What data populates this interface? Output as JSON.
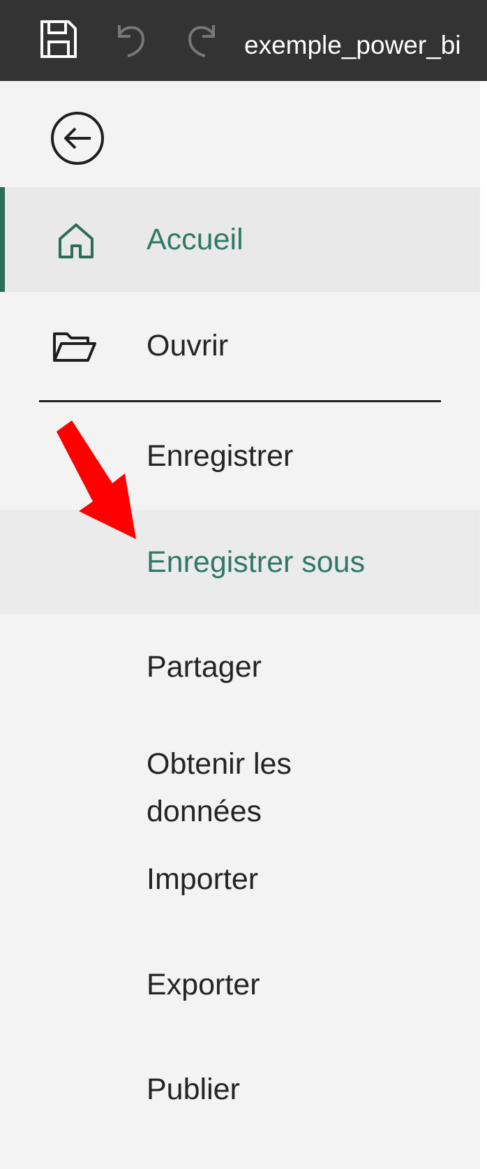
{
  "titlebar": {
    "file_name": "exemple_power_bi",
    "icons": {
      "save": "save-icon",
      "undo": "undo-icon",
      "redo": "redo-icon"
    },
    "background": "#333333"
  },
  "back": {
    "icon": "back-arrow-circle-icon"
  },
  "menu": {
    "items": [
      {
        "label": "Accueil",
        "icon": "home-icon",
        "state": "selected"
      },
      {
        "label": "Ouvrir",
        "icon": "folder-open-icon",
        "state": "normal"
      },
      {
        "label": "Enregistrer",
        "state": "normal"
      },
      {
        "label": "Enregistrer sous",
        "state": "hover"
      },
      {
        "label": "Partager",
        "state": "normal"
      },
      {
        "label": "Obtenir les données",
        "state": "normal"
      },
      {
        "label": "Importer",
        "state": "normal"
      },
      {
        "label": "Exporter",
        "state": "normal"
      },
      {
        "label": "Publier",
        "state": "normal"
      }
    ]
  },
  "annotation": {
    "icon": "red-arrow-annotation",
    "color": "#ff0000",
    "target": "Enregistrer sous"
  },
  "colors": {
    "accent": "#2e6c5a",
    "accent_text": "#2f7a66",
    "panel": "#f3f3f3",
    "text": "#252423"
  }
}
